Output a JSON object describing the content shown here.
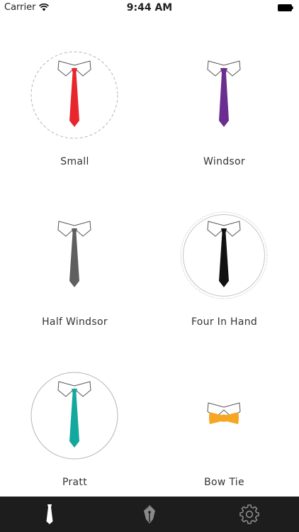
{
  "status_bar": {
    "carrier": "Carrier",
    "time": "9:44 AM"
  },
  "ties": [
    {
      "label": "Small",
      "color": "#e8262e",
      "type": "tie",
      "circle": "dashed"
    },
    {
      "label": "Windsor",
      "color": "#6b2d8f",
      "type": "tie",
      "circle": "none"
    },
    {
      "label": "Half Windsor",
      "color": "#5f5f5f",
      "type": "tie",
      "circle": "none"
    },
    {
      "label": "Four In Hand",
      "color": "#111111",
      "type": "tie",
      "circle": "double-dotted"
    },
    {
      "label": "Pratt",
      "color": "#13a89e",
      "type": "tie",
      "circle": "solid"
    },
    {
      "label": "Bow Tie",
      "color": "#f5a623",
      "type": "bowtie",
      "circle": "none"
    }
  ],
  "tab_bar": {
    "active_color": "#ffffff",
    "inactive_color": "#8a8a8a",
    "tabs": [
      {
        "icon": "necktie-icon",
        "active": true
      },
      {
        "icon": "pen-nib-icon",
        "active": false
      },
      {
        "icon": "gear-icon",
        "active": false
      }
    ]
  }
}
